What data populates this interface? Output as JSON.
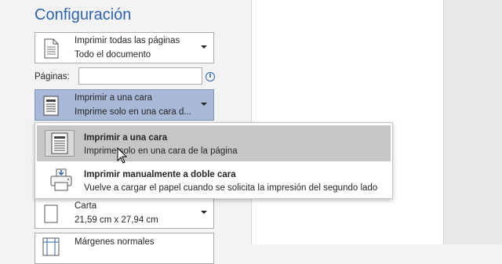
{
  "section": {
    "title": "Configuración"
  },
  "print_range": {
    "label": "Imprimir todas las páginas",
    "sublabel": "Todo el documento",
    "icon": "document-pages-icon"
  },
  "pages": {
    "label": "Páginas:",
    "value": "",
    "info_icon": "info-icon"
  },
  "sides": {
    "label": "Imprimir a una cara",
    "sublabel": "Imprime solo en una cara d...",
    "icon": "single-sided-print-icon"
  },
  "sides_menu": {
    "items": [
      {
        "title": "Imprimir a una cara",
        "desc": "Imprime solo en una cara de la página",
        "icon": "single-sided-print-icon"
      },
      {
        "title": "Imprimir manualmente a doble cara",
        "desc": "Vuelve a cargar el papel cuando se solicita la impresión del segundo lado",
        "icon": "printer-manual-duplex-icon"
      }
    ]
  },
  "paper": {
    "label": "Carta",
    "sublabel": "21,59 cm x 27,94 cm",
    "icon": "paper-size-icon"
  },
  "margins": {
    "label": "Márgenes normales",
    "icon": "margins-icon"
  },
  "colors": {
    "accent": "#2f64ad",
    "selected_bg": "#a7b9d7",
    "hover_bg": "#c6c6c6"
  }
}
